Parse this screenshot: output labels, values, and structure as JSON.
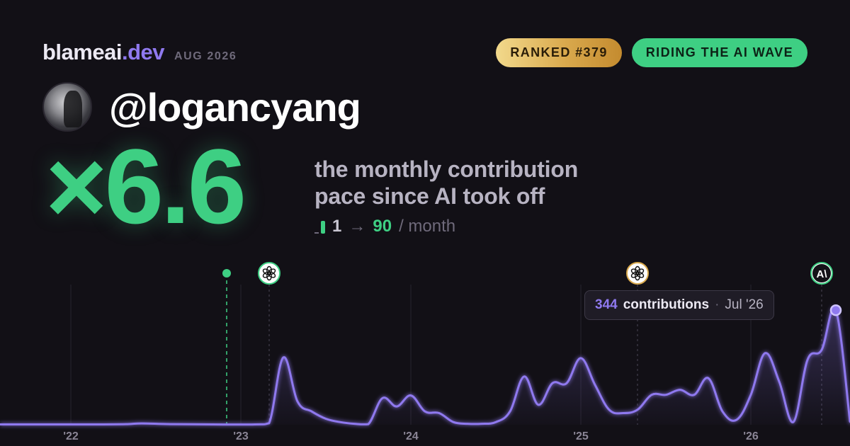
{
  "brand": {
    "name": "blameai",
    "tld": ".dev",
    "date": "AUG 2026"
  },
  "badges": {
    "rank": "RANKED #379",
    "status": "RIDING THE AI WAVE"
  },
  "user": {
    "handle": "@logancyang"
  },
  "headline": {
    "multiplier": "×6.6",
    "line1": "the monthly contribution",
    "line2": "pace since AI took off",
    "from": "1",
    "arrow": "→",
    "to": "90",
    "unit": "/ month"
  },
  "tooltip": {
    "count": "344",
    "label": "contributions",
    "sep": "·",
    "date": "Jul '26"
  },
  "colors": {
    "background": "#121016",
    "accent": "#8f79ef",
    "green": "#3ecf83",
    "gold": "#d9a94d"
  },
  "chart_data": {
    "type": "area",
    "x_tick_labels": [
      "'22",
      "'23",
      "'24",
      "'25",
      "'26"
    ],
    "x_tick_years": [
      2022,
      2023,
      2024,
      2025,
      2026
    ],
    "x_range": [
      "2021-10",
      "2026-08"
    ],
    "y_range": [
      0,
      370
    ],
    "grid": "vertical",
    "series": [
      {
        "values": [
          {
            "date": "2021-10",
            "value": 1
          },
          {
            "date": "2022-03",
            "value": 1
          },
          {
            "date": "2022-05",
            "value": 2
          },
          {
            "date": "2022-06",
            "value": 4
          },
          {
            "date": "2022-08",
            "value": 2
          },
          {
            "date": "2022-11",
            "value": 1
          },
          {
            "date": "2023-02",
            "value": 1
          },
          {
            "date": "2023-03",
            "value": 5
          },
          {
            "date": "2023-04",
            "value": 202
          },
          {
            "date": "2023-05",
            "value": 70
          },
          {
            "date": "2023-06",
            "value": 40
          },
          {
            "date": "2023-07",
            "value": 18
          },
          {
            "date": "2023-08",
            "value": 8
          },
          {
            "date": "2023-09",
            "value": 3
          },
          {
            "date": "2023-10",
            "value": 2
          },
          {
            "date": "2023-11",
            "value": 80
          },
          {
            "date": "2023-12",
            "value": 55
          },
          {
            "date": "2024-01",
            "value": 88
          },
          {
            "date": "2024-02",
            "value": 40
          },
          {
            "date": "2024-03",
            "value": 35
          },
          {
            "date": "2024-04",
            "value": 8
          },
          {
            "date": "2024-05",
            "value": 3
          },
          {
            "date": "2024-06",
            "value": 3
          },
          {
            "date": "2024-07",
            "value": 8
          },
          {
            "date": "2024-08",
            "value": 40
          },
          {
            "date": "2024-09",
            "value": 145
          },
          {
            "date": "2024-10",
            "value": 60
          },
          {
            "date": "2024-11",
            "value": 125
          },
          {
            "date": "2024-12",
            "value": 125
          },
          {
            "date": "2025-01",
            "value": 200
          },
          {
            "date": "2025-02",
            "value": 120
          },
          {
            "date": "2025-03",
            "value": 45
          },
          {
            "date": "2025-04",
            "value": 35
          },
          {
            "date": "2025-05",
            "value": 45
          },
          {
            "date": "2025-06",
            "value": 90
          },
          {
            "date": "2025-07",
            "value": 90
          },
          {
            "date": "2025-08",
            "value": 105
          },
          {
            "date": "2025-09",
            "value": 90
          },
          {
            "date": "2025-10",
            "value": 140
          },
          {
            "date": "2025-11",
            "value": 40
          },
          {
            "date": "2025-12",
            "value": 15
          },
          {
            "date": "2026-01",
            "value": 90
          },
          {
            "date": "2026-02",
            "value": 215
          },
          {
            "date": "2026-03",
            "value": 130
          },
          {
            "date": "2026-04",
            "value": 8
          },
          {
            "date": "2026-05",
            "value": 195
          },
          {
            "date": "2026-06",
            "value": 225
          },
          {
            "date": "2026-07",
            "value": 344
          },
          {
            "date": "2026-08",
            "value": 10
          }
        ]
      }
    ],
    "markers": [
      {
        "date": "2022-12",
        "icon": "green-dot"
      },
      {
        "date": "2023-03",
        "icon": "openai-icon"
      },
      {
        "date": "2025-05",
        "icon": "openai-icon"
      },
      {
        "date": "2026-06",
        "icon": "anthropic-icon"
      }
    ],
    "highlight": {
      "date": "2026-07",
      "value": 344
    }
  }
}
